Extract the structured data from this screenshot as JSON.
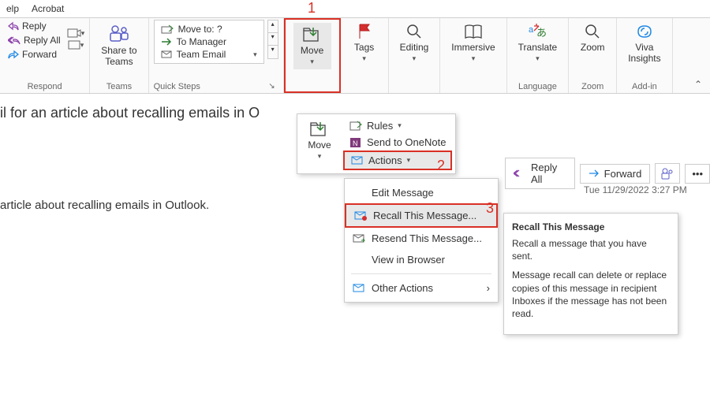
{
  "tabs": {
    "help": "elp",
    "acrobat": "Acrobat"
  },
  "ribbon": {
    "respond": {
      "reply": "Reply",
      "reply_all": "Reply All",
      "forward": "Forward",
      "label": "Respond"
    },
    "teams": {
      "share": "Share to\nTeams",
      "label": "Teams"
    },
    "quicksteps": {
      "move_to": "Move to: ?",
      "to_manager": "To Manager",
      "team_email": "Team Email",
      "label": "Quick Steps"
    },
    "move": {
      "label": "Move",
      "group_label": ""
    },
    "tags": {
      "label": "Tags"
    },
    "editing": {
      "label": "Editing"
    },
    "immersive": {
      "label": "Immersive"
    },
    "translate": {
      "label": "Translate",
      "group_label": "Language"
    },
    "zoom": {
      "label": "Zoom",
      "group_label": "Zoom"
    },
    "viva": {
      "label": "Viva\nInsights",
      "group_label": "Add-in"
    }
  },
  "annotations": {
    "a1": "1",
    "a2": "2",
    "a3": "3"
  },
  "content": {
    "line1": "il for an article about recalling emails in O",
    "line2": "article about recalling emails in Outlook."
  },
  "move_popup": {
    "move": "Move",
    "rules": "Rules",
    "onenote": "Send to OneNote",
    "actions": "Actions"
  },
  "actions_menu": {
    "edit": "Edit Message",
    "recall": "Recall This Message...",
    "resend": "Resend This Message...",
    "view": "View in Browser",
    "other": "Other Actions"
  },
  "reply_bar": {
    "reply_all": "Reply All",
    "forward": "Forward"
  },
  "timestamp": "Tue 11/29/2022 3:27 PM",
  "tooltip": {
    "title": "Recall This Message",
    "p1": "Recall a message that you have sent.",
    "p2": "Message recall can delete or replace copies of this message in recipient Inboxes if the message has not been read."
  }
}
